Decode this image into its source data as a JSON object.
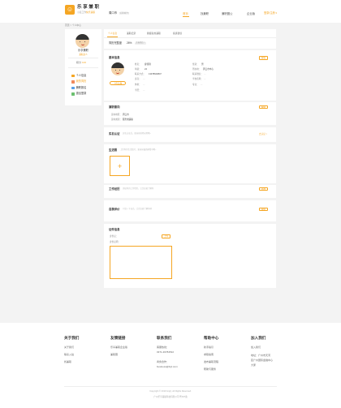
{
  "header": {
    "logo_char": "☺",
    "brand_name": "乐 享 兼 职",
    "slogan_a": "小蓝工作",
    "slogan_b": "快乐兼职",
    "city": "周口市",
    "city_switch": "[切换城市]",
    "nav": [
      "首页",
      "找兼职",
      "兼职圈公",
      "企业版"
    ],
    "login": "登录/注册 ▾"
  },
  "breadcrumb": "首页 > 个人中心",
  "sidebar": {
    "username": "乐享兼职",
    "user_tag": "兼职达人",
    "points_label": "积分",
    "points_value": "100",
    "items": [
      "个人信息",
      "我的简历",
      "兼职报名",
      "退出登录"
    ]
  },
  "tabs": [
    "个人信息",
    "兼职记录",
    "我报名的兼职",
    "投诉建议"
  ],
  "completeness": {
    "label": "简历完整度",
    "value": "26%",
    "badge": "完善简历 >"
  },
  "basic": {
    "title": "基本信息",
    "edit": "编辑",
    "upload": "上传头像",
    "left_fields": [
      {
        "label": "姓名：",
        "value": "廖佳琪"
      },
      {
        "label": "年龄：",
        "value": "24"
      },
      {
        "label": "联系方式：",
        "value": "13378643847"
      },
      {
        "label": "身高：",
        "value": "—"
      },
      {
        "label": "体重：",
        "value": "—"
      },
      {
        "label": "学历：",
        "value": "—"
      }
    ],
    "right_fields": [
      {
        "label": "性别：",
        "value": "男"
      },
      {
        "label": "所在地：",
        "value": "周口市中心"
      },
      {
        "label": "联系微信：",
        "value": "—"
      },
      {
        "label": "学校名称：",
        "value": "—"
      },
      {
        "label": "专业：",
        "value": "—"
      }
    ]
  },
  "intent": {
    "title": "兼职意向",
    "edit": "编辑",
    "fields": [
      {
        "label": "意向地区：",
        "value": "周口市"
      },
      {
        "label": "意向类别：",
        "value": "服务类兼职"
      }
    ]
  },
  "verify": {
    "title": "实名认证",
    "hint": "实名认证后，更容易获得录用哦~",
    "action": "去认证 >"
  },
  "photos": {
    "title": "生活照",
    "hint": "上传你的生活照片，更容易被商家看中哦~",
    "add": "+"
  },
  "experience": {
    "title": "工作经历",
    "hint": "添加你的工作经历，让企业更了解你",
    "edit": "添加"
  },
  "self_eval": {
    "title": "自我评价",
    "hint": "介绍一下自己，让企业更了解你吧",
    "edit": "编辑"
  },
  "certificates": {
    "title": "证件信息",
    "field1": "身份证：",
    "field1_btn": "上传",
    "field2": "身份证明："
  },
  "footer": {
    "columns": [
      {
        "title": "关于我们",
        "links": [
          "关于我们",
          "联系入驻",
          "找兼职"
        ]
      },
      {
        "title": "友情链接",
        "links": [
          "乐享兼职企业版",
          "兼职圈"
        ]
      },
      {
        "title": "联系我们",
        "links": [
          "客服热线：",
          "0371-36784532",
          "商务合作：",
          "business@lxjz.com"
        ]
      },
      {
        "title": "帮助中心",
        "links": [
          "新手指引",
          "求职指南",
          "发布兼职流程",
          "帮助与服务"
        ]
      },
      {
        "title": "加入我们",
        "links": [
          "加入我们",
          "地址：广州市天河",
          "区广州国际金融中心",
          "大厦"
        ]
      }
    ],
    "copyright": "Copyright © 2019 lxnjzj. All Rights Reserved.",
    "icp": "广州乐享兼职科技有限公司 粤ICP备"
  }
}
